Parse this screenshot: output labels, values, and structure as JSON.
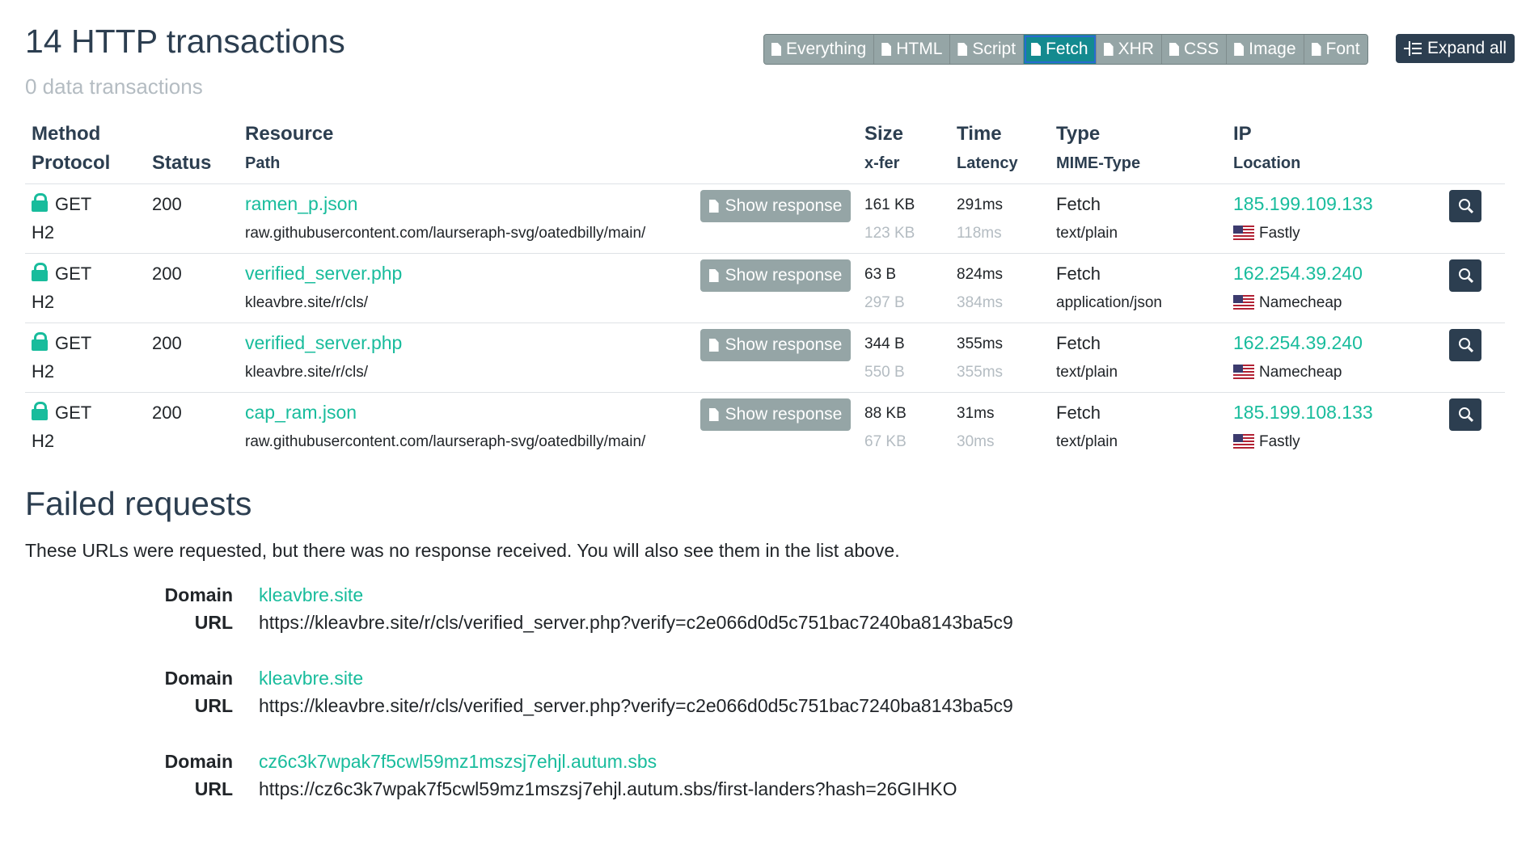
{
  "header": {
    "title": "14 HTTP transactions",
    "subtitle": "0 data transactions"
  },
  "filters": [
    {
      "label": "Everything",
      "active": false
    },
    {
      "label": "HTML",
      "active": false
    },
    {
      "label": "Script",
      "active": false
    },
    {
      "label": "Fetch",
      "active": true
    },
    {
      "label": "XHR",
      "active": false
    },
    {
      "label": "CSS",
      "active": false
    },
    {
      "label": "Image",
      "active": false
    },
    {
      "label": "Font",
      "active": false
    }
  ],
  "expand_all_label": "Expand all",
  "columns": {
    "method": "Method",
    "protocol": "Protocol",
    "status": "Status",
    "resource": "Resource",
    "path": "Path",
    "size": "Size",
    "xfer": "x-fer",
    "time": "Time",
    "latency": "Latency",
    "type": "Type",
    "mime": "MIME-Type",
    "ip": "IP",
    "location": "Location"
  },
  "show_response_label": "Show response",
  "rows": [
    {
      "method": "GET",
      "protocol": "H2",
      "status": "200",
      "resource": "ramen_p.json",
      "path": "raw.githubusercontent.com/laurseraph-svg/oatedbilly/main/",
      "size": "161 KB",
      "xfer": "123 KB",
      "time": "291ms",
      "latency": "118ms",
      "type": "Fetch",
      "mime": "text/plain",
      "ip": "185.199.109.133",
      "location": "Fastly"
    },
    {
      "method": "GET",
      "protocol": "H2",
      "status": "200",
      "resource": "verified_server.php",
      "path": "kleavbre.site/r/cls/",
      "size": "63 B",
      "xfer": "297 B",
      "time": "824ms",
      "latency": "384ms",
      "type": "Fetch",
      "mime": "application/json",
      "ip": "162.254.39.240",
      "location": "Namecheap"
    },
    {
      "method": "GET",
      "protocol": "H2",
      "status": "200",
      "resource": "verified_server.php",
      "path": "kleavbre.site/r/cls/",
      "size": "344 B",
      "xfer": "550 B",
      "time": "355ms",
      "latency": "355ms",
      "type": "Fetch",
      "mime": "text/plain",
      "ip": "162.254.39.240",
      "location": "Namecheap"
    },
    {
      "method": "GET",
      "protocol": "H2",
      "status": "200",
      "resource": "cap_ram.json",
      "path": "raw.githubusercontent.com/laurseraph-svg/oatedbilly/main/",
      "size": "88 KB",
      "xfer": "67 KB",
      "time": "31ms",
      "latency": "30ms",
      "type": "Fetch",
      "mime": "text/plain",
      "ip": "185.199.108.133",
      "location": "Fastly"
    }
  ],
  "failed": {
    "title": "Failed requests",
    "description": "These URLs were requested, but there was no response received. You will also see them in the list above.",
    "domain_label": "Domain",
    "url_label": "URL",
    "items": [
      {
        "domain": "kleavbre.site",
        "url": "https://kleavbre.site/r/cls/verified_server.php?verify=c2e066d0d5c751bac7240ba8143ba5c9"
      },
      {
        "domain": "kleavbre.site",
        "url": "https://kleavbre.site/r/cls/verified_server.php?verify=c2e066d0d5c751bac7240ba8143ba5c9"
      },
      {
        "domain": "cz6c3k7wpak7f5cwl59mz1mszsj7ehjl.autum.sbs",
        "url": "https://cz6c3k7wpak7f5cwl59mz1mszsj7ehjl.autum.sbs/first-landers?hash=26GIHKO"
      }
    ]
  }
}
